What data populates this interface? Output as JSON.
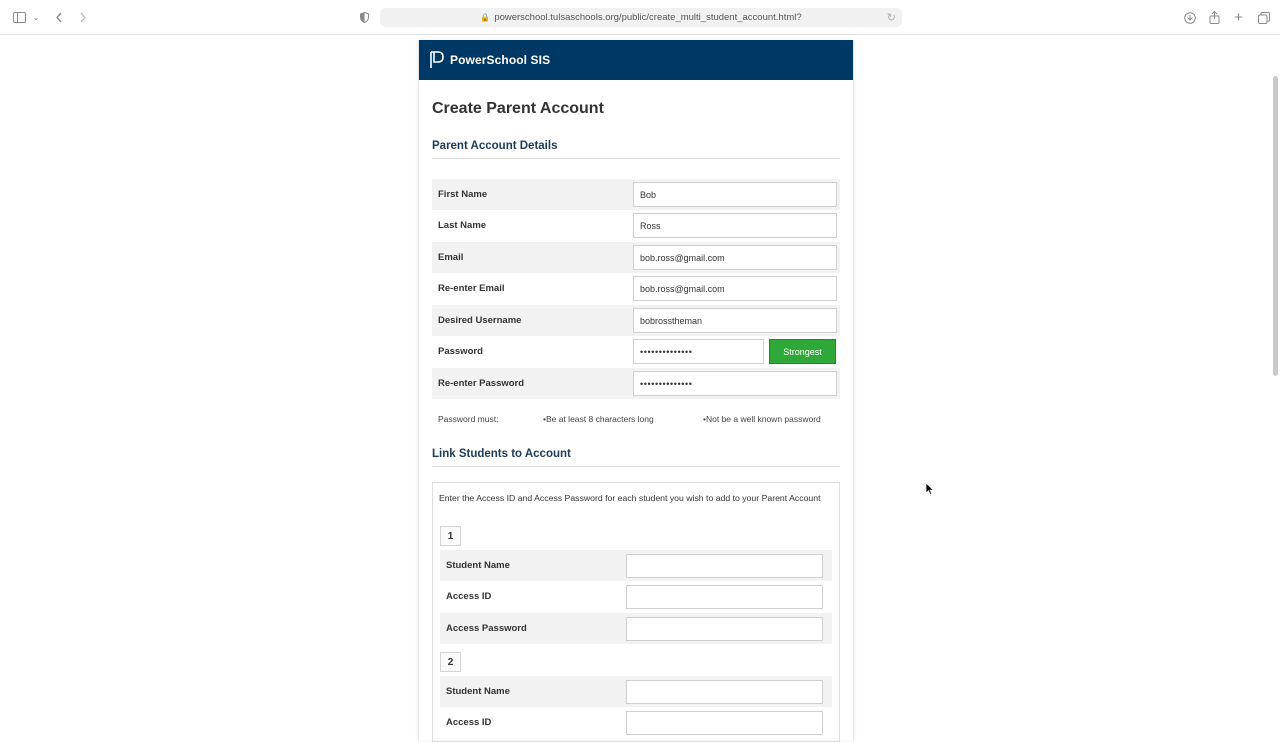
{
  "browser": {
    "url": "powerschool.tulsaschools.org/public/create_multi_student_account.html?"
  },
  "brand": {
    "name": "PowerSchool SIS",
    "bar_color": "#003865"
  },
  "page": {
    "title": "Create Parent Account"
  },
  "parent_details": {
    "heading": "Parent Account Details",
    "first_name": {
      "label": "First Name",
      "value": "Bob"
    },
    "last_name": {
      "label": "Last Name",
      "value": "Ross"
    },
    "email": {
      "label": "Email",
      "value": "bob.ross@gmail.com"
    },
    "reenter_email": {
      "label": "Re-enter Email",
      "value": "bob.ross@gmail.com"
    },
    "username": {
      "label": "Desired Username",
      "value": "bobrosstheman"
    },
    "password": {
      "label": "Password",
      "value": "••••••••••••••",
      "strength": "Strongest"
    },
    "reenter_password": {
      "label": "Re-enter Password",
      "value": "••••••••••••••"
    },
    "password_rules": {
      "lead": "Password must:",
      "rule1": "•Be at least 8 characters long",
      "rule2": "•Not be a well known password"
    }
  },
  "link_students": {
    "heading": "Link Students to Account",
    "intro": "Enter the Access ID and Access Password for each student you wish to add to your Parent Account",
    "students": [
      {
        "number": "1",
        "name_label": "Student Name",
        "access_id_label": "Access ID",
        "access_password_label": "Access Password"
      },
      {
        "number": "2",
        "name_label": "Student Name",
        "access_id_label": "Access ID"
      }
    ]
  },
  "colors": {
    "strength_green": "#2fa83a",
    "section_heading": "#1e3a5a"
  }
}
